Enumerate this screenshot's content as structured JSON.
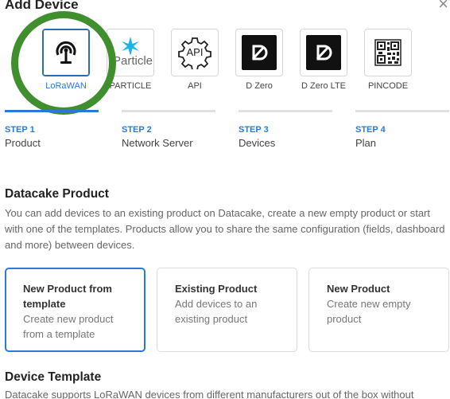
{
  "header": {
    "title": "Add Device",
    "close_symbol": "×"
  },
  "device_types": [
    {
      "label": "LoRaWAN",
      "icon": "lorawan-antenna-icon",
      "selected": true
    },
    {
      "label": "PARTICLE",
      "icon": "particle-logo-icon",
      "selected": false
    },
    {
      "label": "API",
      "icon": "api-gear-icon",
      "selected": false
    },
    {
      "label": "D Zero",
      "icon": "dzero-logo-icon",
      "selected": false
    },
    {
      "label": "D Zero LTE",
      "icon": "dzero-lte-logo-icon",
      "selected": false
    },
    {
      "label": "PINCODE",
      "icon": "qr-code-icon",
      "selected": false
    }
  ],
  "particle_logo_text": "Particle",
  "api_icon_text": "API",
  "steps": [
    {
      "num": "STEP 1",
      "name": "Product",
      "active": true
    },
    {
      "num": "STEP 2",
      "name": "Network Server",
      "active": false
    },
    {
      "num": "STEP 3",
      "name": "Devices",
      "active": false
    },
    {
      "num": "STEP 4",
      "name": "Plan",
      "active": false
    }
  ],
  "product_section": {
    "title": "Datacake Product",
    "description": "You can add devices to an existing product on Datacake, create a new empty product or start with one of the templates. Products allow you to share the same configuration (fields, dashboard and more) between devices."
  },
  "product_options": [
    {
      "title": "New Product from template",
      "desc": "Create new product from a template",
      "selected": true
    },
    {
      "title": "Existing Product",
      "desc": "Add devices to an existing product",
      "selected": false
    },
    {
      "title": "New Product",
      "desc": "Create new empty product",
      "selected": false
    }
  ],
  "template_section": {
    "title": "Device Template",
    "description": "Datacake supports LoRaWAN devices from different manufacturers out of the box without"
  },
  "colors": {
    "accent": "#2a7ad5",
    "highlight_ring": "#3f8f2f"
  }
}
